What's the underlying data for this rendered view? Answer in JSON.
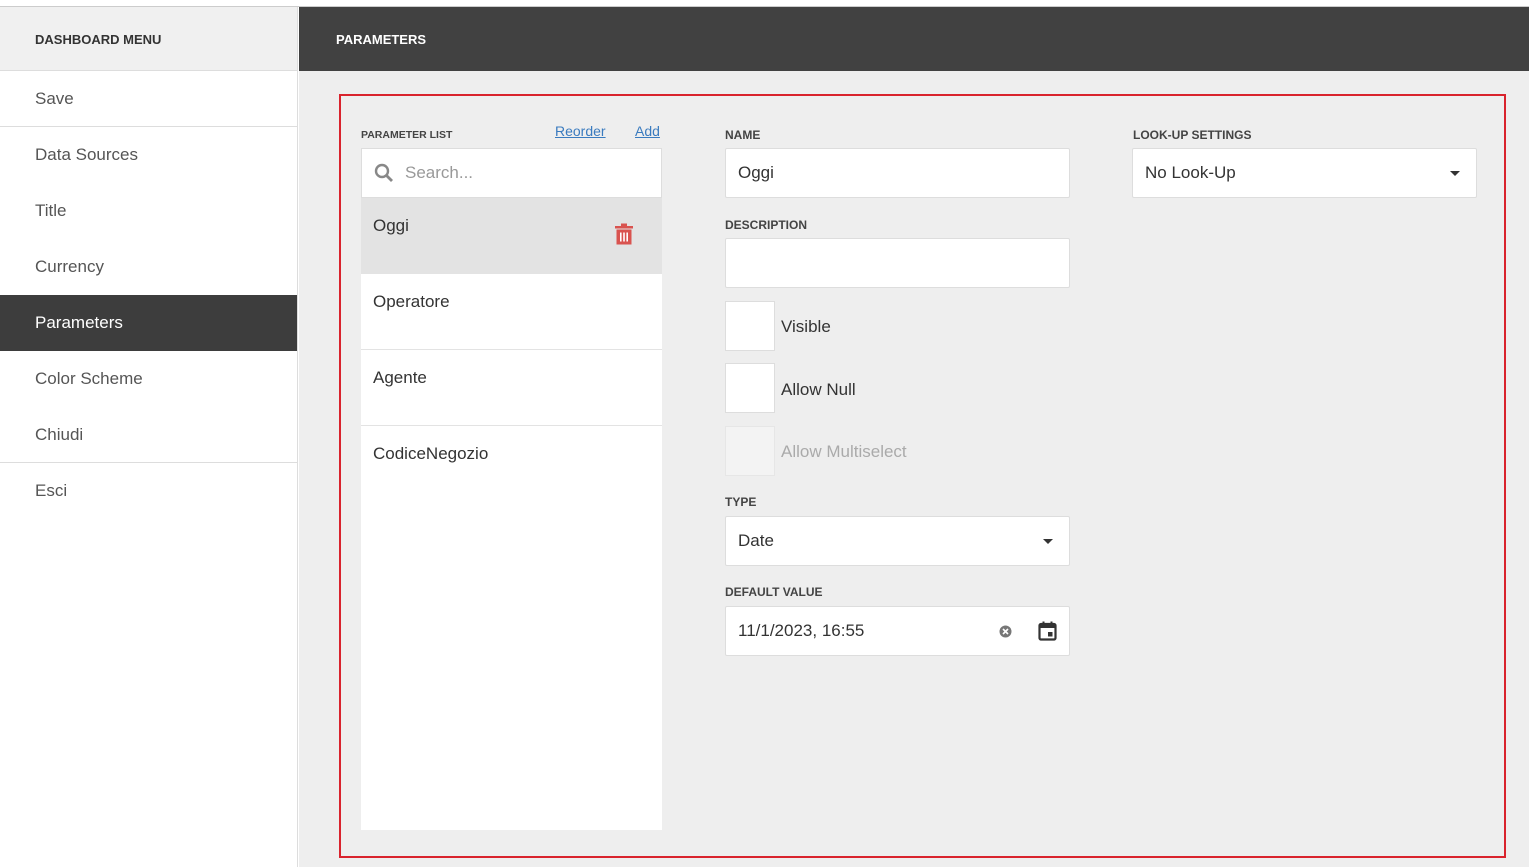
{
  "sidebar": {
    "title": "DASHBOARD MENU",
    "items": [
      {
        "label": "Save"
      },
      {
        "label": "Data Sources"
      },
      {
        "label": "Title"
      },
      {
        "label": "Currency"
      },
      {
        "label": "Parameters"
      },
      {
        "label": "Color Scheme"
      },
      {
        "label": "Chiudi"
      },
      {
        "label": "Esci"
      }
    ]
  },
  "header": {
    "title": "PARAMETERS"
  },
  "param_list": {
    "label": "PARAMETER LIST",
    "reorder": "Reorder",
    "add": "Add",
    "search_placeholder": "Search...",
    "items": [
      {
        "name": "Oggi"
      },
      {
        "name": "Operatore"
      },
      {
        "name": "Agente"
      },
      {
        "name": "CodiceNegozio"
      }
    ]
  },
  "form": {
    "name_label": "NAME",
    "name_value": "Oggi",
    "description_label": "DESCRIPTION",
    "description_value": "",
    "visible": "Visible",
    "allow_null": "Allow Null",
    "allow_multiselect": "Allow Multiselect",
    "type_label": "TYPE",
    "type_value": "Date",
    "default_label": "DEFAULT VALUE",
    "default_value": "11/1/2023, 16:55",
    "lookup_label": "LOOK-UP SETTINGS",
    "lookup_value": "No Look-Up"
  },
  "colors": {
    "accent": "#d9232d",
    "link": "#3a7bbf",
    "active": "#3d3d3d"
  }
}
